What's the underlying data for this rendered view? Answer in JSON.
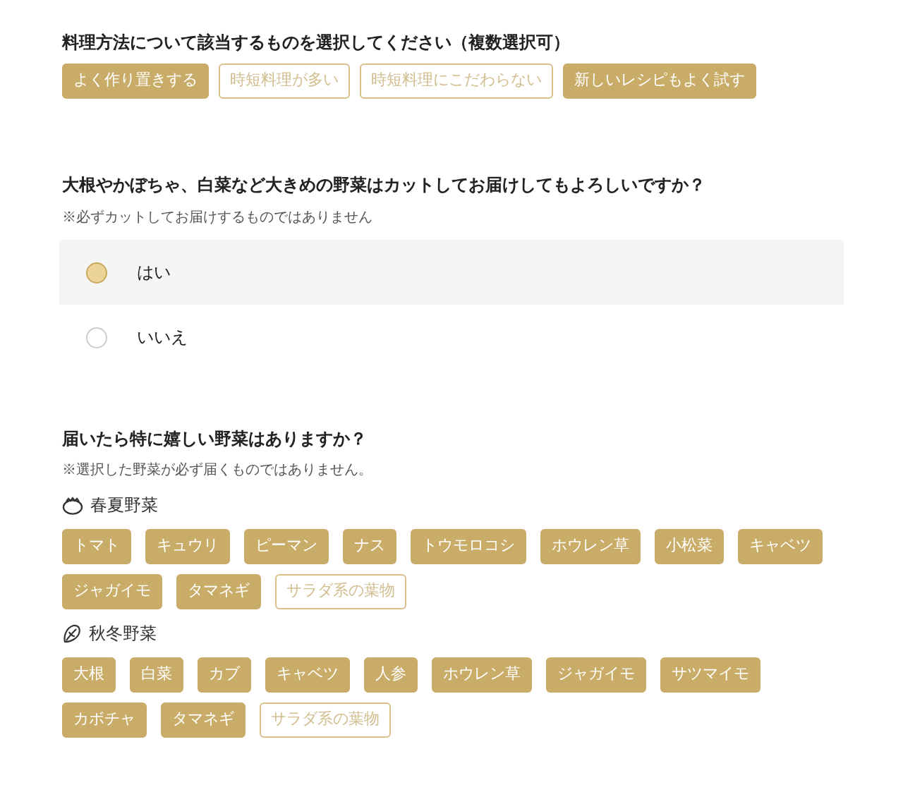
{
  "cooking": {
    "title": "料理方法について該当するものを選択してください（複数選択可）",
    "options": [
      {
        "label": "よく作り置きする",
        "selected": true
      },
      {
        "label": "時短料理が多い",
        "selected": false
      },
      {
        "label": "時短料理にこだわらない",
        "selected": false
      },
      {
        "label": "新しいレシピもよく試す",
        "selected": true
      }
    ]
  },
  "cut": {
    "title": "大根やかぼちゃ、白菜など大きめの野菜はカットしてお届けしてもよろしいですか？",
    "note": "※必ずカットしてお届けするものではありません",
    "options": [
      {
        "label": "はい",
        "selected": true
      },
      {
        "label": "いいえ",
        "selected": false
      }
    ]
  },
  "vegetables": {
    "title": "届いたら特に嬉しい野菜はありますか？",
    "note": "※選択した野菜が必ず届くものではありません。",
    "groups": [
      {
        "kind": "tomato",
        "label": "春夏野菜",
        "items": [
          {
            "label": "トマト",
            "selected": true
          },
          {
            "label": "キュウリ",
            "selected": true
          },
          {
            "label": "ピーマン",
            "selected": true
          },
          {
            "label": "ナス",
            "selected": true
          },
          {
            "label": "トウモロコシ",
            "selected": true
          },
          {
            "label": "ホウレン草",
            "selected": true
          },
          {
            "label": "小松菜",
            "selected": true
          },
          {
            "label": "キャベツ",
            "selected": true
          },
          {
            "label": "ジャガイモ",
            "selected": true
          },
          {
            "label": "タマネギ",
            "selected": true
          },
          {
            "label": "サラダ系の葉物",
            "selected": false
          }
        ]
      },
      {
        "kind": "leaf",
        "label": "秋冬野菜",
        "items": [
          {
            "label": "大根",
            "selected": true
          },
          {
            "label": "白菜",
            "selected": true
          },
          {
            "label": "カブ",
            "selected": true
          },
          {
            "label": "キャベツ",
            "selected": true
          },
          {
            "label": "人参",
            "selected": true
          },
          {
            "label": "ホウレン草",
            "selected": true
          },
          {
            "label": "ジャガイモ",
            "selected": true
          },
          {
            "label": "サツマイモ",
            "selected": true
          },
          {
            "label": "カボチャ",
            "selected": true
          },
          {
            "label": "タマネギ",
            "selected": true
          },
          {
            "label": "サラダ系の葉物",
            "selected": false
          }
        ]
      }
    ]
  }
}
